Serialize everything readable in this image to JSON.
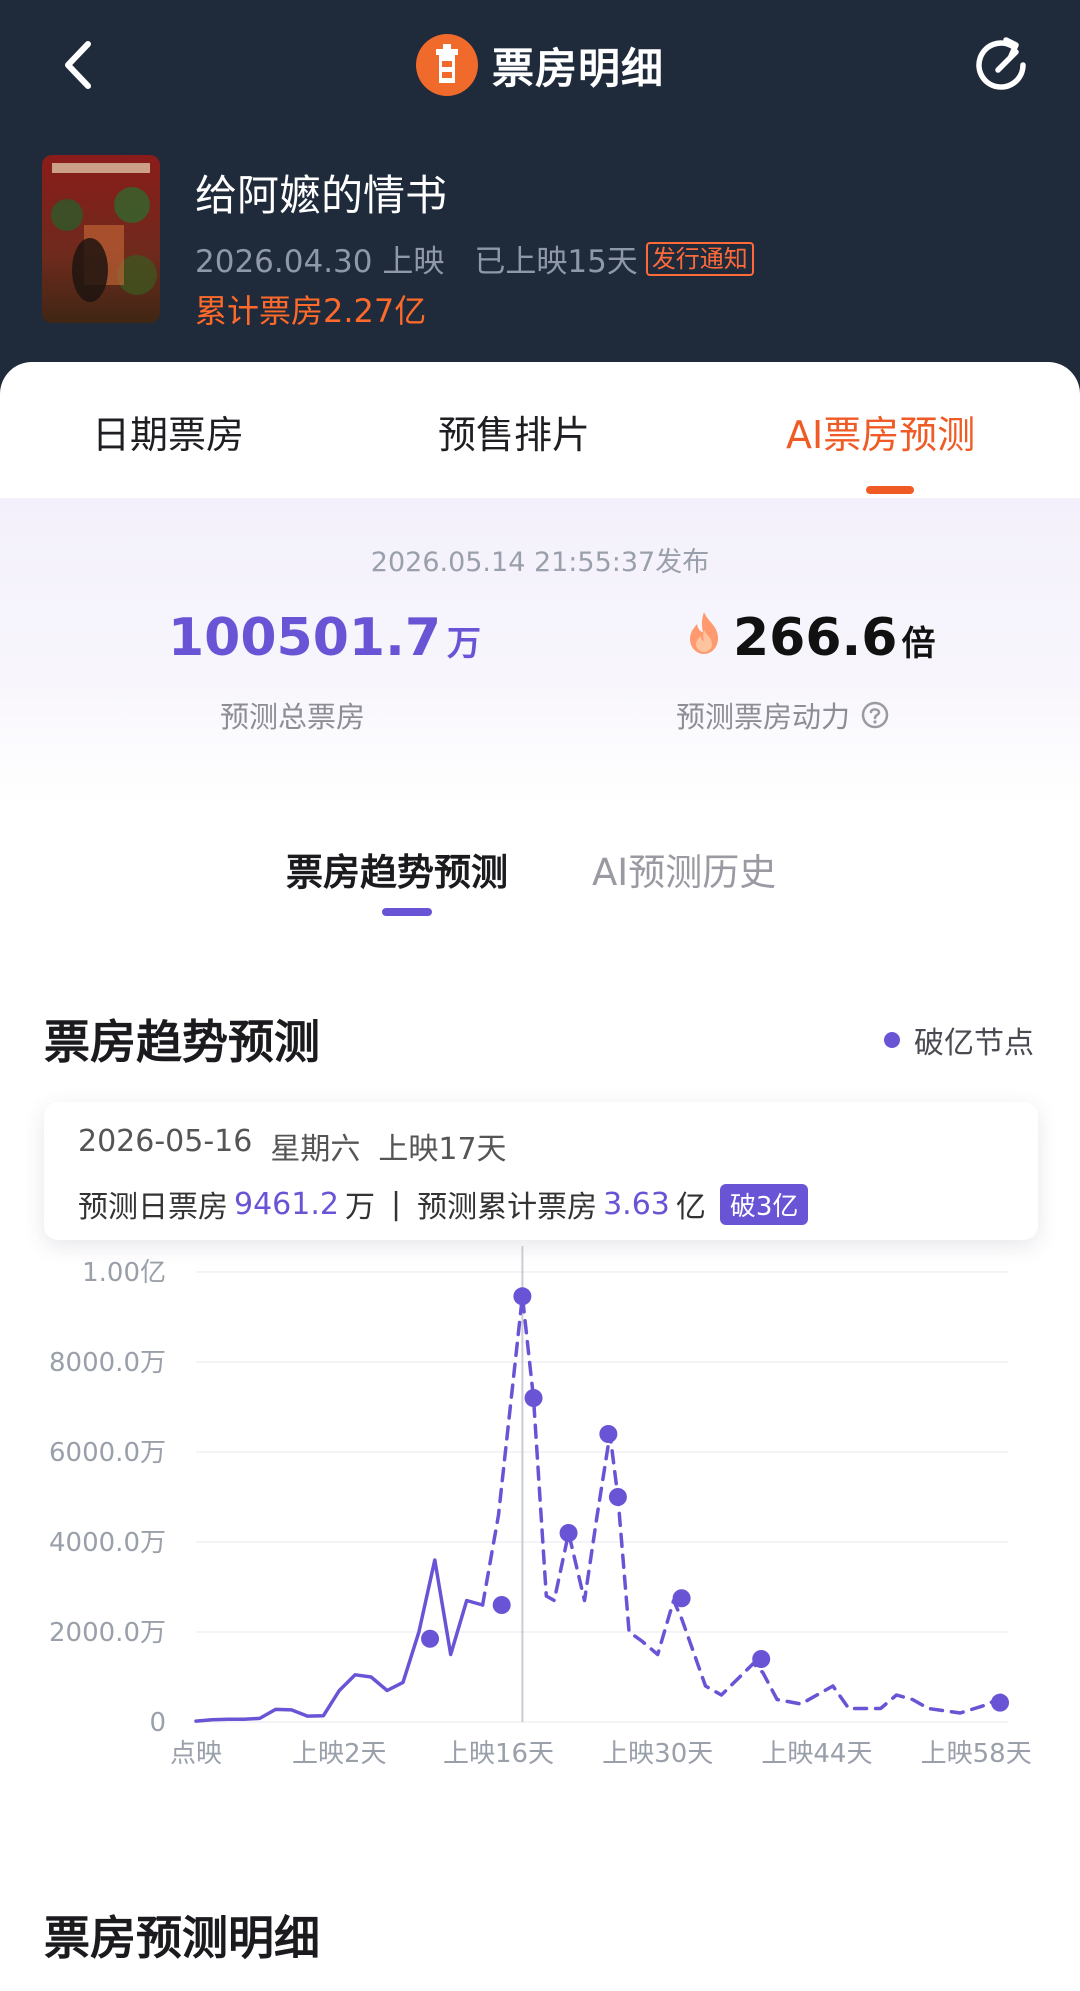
{
  "app": {
    "title": "票房明细"
  },
  "movie": {
    "title": "给阿嬷的情书",
    "release_date": "2026.04.30 上映",
    "days_released": "已上映15天",
    "notice_badge": "发行通知",
    "total_box": "累计票房2.27亿"
  },
  "tabs": [
    {
      "label": "日期票房",
      "active": false
    },
    {
      "label": "预售排片",
      "active": false
    },
    {
      "label": "AI票房预测",
      "active": true
    }
  ],
  "prediction": {
    "publish_time": "2026.05.14 21:55:37发布",
    "total_value": "100501.7",
    "total_unit": "万",
    "total_label": "预测总票房",
    "power_value": "266.6",
    "power_unit": "倍",
    "power_label": "预测票房动力"
  },
  "subtabs": [
    {
      "label": "票房趋势预测",
      "active": true
    },
    {
      "label": "AI预测历史",
      "active": false
    }
  ],
  "trend": {
    "section_title": "票房趋势预测",
    "legend_label": "破亿节点"
  },
  "tooltip": {
    "date": "2026-05-16",
    "weekday": "星期六",
    "days": "上映17天",
    "daily_label": "预测日票房",
    "daily_value": "9461.2",
    "daily_unit": "万",
    "cum_label": "预测累计票房",
    "cum_value": "3.63",
    "cum_unit": "亿",
    "badge": "破3亿"
  },
  "detail": {
    "section_title": "票房预测明细"
  },
  "colors": {
    "accent": "#f05a25",
    "purple": "#6a54d6",
    "header_bg": "#1f2a3b"
  },
  "chart_data": {
    "type": "line",
    "y_unit": "万",
    "ylim": [
      0,
      10000
    ],
    "yticks": [
      0,
      2000,
      4000,
      6000,
      8000,
      10000
    ],
    "ytick_labels": [
      "0",
      "2000.0万",
      "4000.0万",
      "6000.0万",
      "8000.0万",
      "1.00亿"
    ],
    "xticks": [
      0,
      9,
      19,
      29,
      39,
      49
    ],
    "xtick_labels": [
      "点映",
      "上映2天",
      "上映16天",
      "上映30天",
      "上映44天",
      "上映58天"
    ],
    "x_max": 51,
    "highlight_x": 20.5,
    "series": [
      {
        "style": "solid",
        "points": [
          [
            0,
            20
          ],
          [
            1,
            50
          ],
          [
            2,
            60
          ],
          [
            3,
            60
          ],
          [
            4,
            80
          ],
          [
            5,
            280
          ],
          [
            6,
            270
          ],
          [
            7,
            130
          ],
          [
            8,
            140
          ],
          [
            9,
            700
          ],
          [
            10,
            1050
          ],
          [
            11,
            1000
          ],
          [
            12,
            700
          ],
          [
            13,
            880
          ],
          [
            14,
            2000
          ],
          [
            15,
            3600
          ],
          [
            16,
            1500
          ],
          [
            17,
            2700
          ],
          [
            18,
            2600
          ]
        ]
      },
      {
        "style": "dashed",
        "points": [
          [
            18,
            2600
          ],
          [
            19,
            4600
          ],
          [
            20.5,
            9461
          ],
          [
            21.2,
            7200
          ],
          [
            22,
            2800
          ],
          [
            22.5,
            2700
          ],
          [
            23.4,
            4200
          ],
          [
            24.4,
            2700
          ],
          [
            25.2,
            4600
          ],
          [
            26,
            6400
          ],
          [
            26.5,
            5000
          ],
          [
            27.2,
            2000
          ],
          [
            28,
            1800
          ],
          [
            29,
            1500
          ],
          [
            30,
            2700
          ],
          [
            30.5,
            2300
          ],
          [
            32,
            800
          ],
          [
            33,
            600
          ],
          [
            35,
            1300
          ],
          [
            35.6,
            1100
          ],
          [
            36.5,
            500
          ],
          [
            38,
            400
          ],
          [
            40,
            800
          ],
          [
            41,
            300
          ],
          [
            43,
            300
          ],
          [
            44,
            600
          ],
          [
            45,
            500
          ],
          [
            46,
            300
          ],
          [
            48,
            200
          ],
          [
            49.8,
            400
          ],
          [
            51,
            700
          ]
        ]
      }
    ],
    "milestones": [
      [
        14.7,
        1850
      ],
      [
        19.2,
        2600
      ],
      [
        20.5,
        9461
      ],
      [
        21.2,
        7200
      ],
      [
        23.4,
        4200
      ],
      [
        25.9,
        6400
      ],
      [
        26.5,
        5000
      ],
      [
        30.5,
        2750
      ],
      [
        35.5,
        1400
      ],
      [
        50.5,
        430
      ]
    ]
  }
}
